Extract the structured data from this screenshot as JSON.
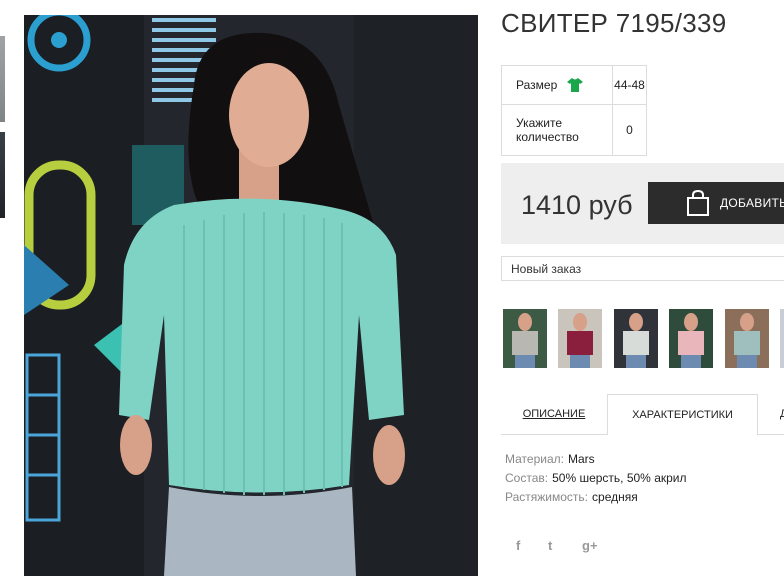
{
  "product": {
    "title": "СВИТЕР 7195/339"
  },
  "options": {
    "size_label": "Размер",
    "size_value": "44-48",
    "qty_label_line1": "Укажите",
    "qty_label_line2": "количество",
    "qty_value": "0"
  },
  "price": {
    "text": "1410 руб",
    "add_button": "ДОБАВИТЬ"
  },
  "order_select": {
    "selected": "Новый заказ"
  },
  "gallery": {
    "thumb_colors": [
      "#b9b7b1",
      "#8a1f3d",
      "#d8dcd9",
      "#e8b6bb",
      "#9fbfbf",
      "#c8ced4"
    ]
  },
  "tabs": {
    "description": "ОПИСАНИЕ",
    "characteristics": "ХАРАКТЕРИСТИКИ",
    "more": "Д"
  },
  "characteristics": {
    "material_key": "Материал:",
    "material_val": "Mars",
    "composition_key": "Состав:",
    "composition_val": "50% шерсть, 50% акрил",
    "stretch_key": "Растяжимость:",
    "stretch_val": "средняя"
  },
  "social": {
    "facebook": "f",
    "twitter": "t",
    "gplus": "g+"
  },
  "colors": {
    "sweater": "#7fd3c4",
    "button": "#2c2c2c",
    "price_bg": "#eeeeee",
    "size_icon": "#1aa64b"
  }
}
